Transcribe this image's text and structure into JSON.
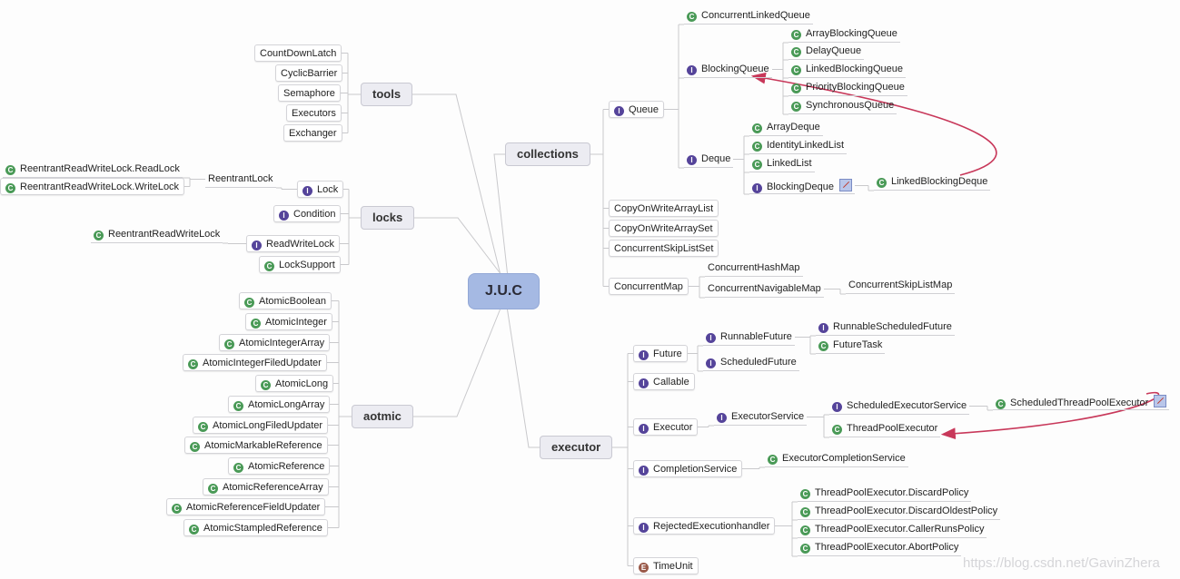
{
  "root": {
    "id": "juc",
    "label": "J.U.C"
  },
  "branches": [
    {
      "id": "tools",
      "label": "tools"
    },
    {
      "id": "locks",
      "label": "locks"
    },
    {
      "id": "aotmic",
      "label": "aotmic"
    },
    {
      "id": "collections",
      "label": "collections"
    },
    {
      "id": "executor",
      "label": "executor"
    }
  ],
  "nodes": [
    {
      "id": "t1",
      "label": "CountDownLatch",
      "kind": "none",
      "style": "box",
      "parent": "tools"
    },
    {
      "id": "t2",
      "label": "CyclicBarrier",
      "kind": "none",
      "style": "box",
      "parent": "tools"
    },
    {
      "id": "t3",
      "label": "Semaphore",
      "kind": "none",
      "style": "box",
      "parent": "tools"
    },
    {
      "id": "t4",
      "label": "Executors",
      "kind": "none",
      "style": "box",
      "parent": "tools"
    },
    {
      "id": "t5",
      "label": "Exchanger",
      "kind": "none",
      "style": "box",
      "parent": "tools"
    },
    {
      "id": "l1",
      "label": "Lock",
      "kind": "interface",
      "style": "box",
      "parent": "locks"
    },
    {
      "id": "l2",
      "label": "Condition",
      "kind": "interface",
      "style": "box",
      "parent": "locks"
    },
    {
      "id": "l3",
      "label": "ReadWriteLock",
      "kind": "interface",
      "style": "box",
      "parent": "locks"
    },
    {
      "id": "l4",
      "label": "LockSupport",
      "kind": "class",
      "style": "box",
      "parent": "locks"
    },
    {
      "id": "l1a",
      "label": "ReentrantLock",
      "kind": "none",
      "style": "plain",
      "parent": "l1"
    },
    {
      "id": "l1b",
      "label": "ReentrantReadWriteLock.ReadLock",
      "kind": "class",
      "style": "plain",
      "parent": "l1a"
    },
    {
      "id": "l1c",
      "label": "ReentrantReadWriteLock.WriteLock",
      "kind": "class",
      "style": "box",
      "parent": "l1a"
    },
    {
      "id": "l3a",
      "label": "ReentrantReadWriteLock",
      "kind": "class",
      "style": "plain",
      "parent": "l3"
    },
    {
      "id": "a1",
      "label": "AtomicBoolean",
      "kind": "class",
      "style": "box",
      "parent": "aotmic"
    },
    {
      "id": "a2",
      "label": "AtomicInteger",
      "kind": "class",
      "style": "box",
      "parent": "aotmic"
    },
    {
      "id": "a3",
      "label": "AtomicIntegerArray",
      "kind": "class",
      "style": "box",
      "parent": "aotmic"
    },
    {
      "id": "a4",
      "label": "AtomicIntegerFiledUpdater",
      "kind": "class",
      "style": "box",
      "parent": "aotmic"
    },
    {
      "id": "a5",
      "label": "AtomicLong",
      "kind": "class",
      "style": "box",
      "parent": "aotmic"
    },
    {
      "id": "a6",
      "label": "AtomicLongArray",
      "kind": "class",
      "style": "box",
      "parent": "aotmic"
    },
    {
      "id": "a7",
      "label": "AtomicLongFiledUpdater",
      "kind": "class",
      "style": "box",
      "parent": "aotmic"
    },
    {
      "id": "a8",
      "label": "AtomicMarkableReference",
      "kind": "class",
      "style": "box",
      "parent": "aotmic"
    },
    {
      "id": "a9",
      "label": "AtomicReference",
      "kind": "class",
      "style": "box",
      "parent": "aotmic"
    },
    {
      "id": "a10",
      "label": "AtomicReferenceArray",
      "kind": "class",
      "style": "box",
      "parent": "aotmic"
    },
    {
      "id": "a11",
      "label": "AtomicReferenceFieldUpdater",
      "kind": "class",
      "style": "box",
      "parent": "aotmic"
    },
    {
      "id": "a12",
      "label": "AtomicStampledReference",
      "kind": "class",
      "style": "box",
      "parent": "aotmic"
    },
    {
      "id": "c1",
      "label": "Queue",
      "kind": "interface",
      "style": "box",
      "parent": "collections"
    },
    {
      "id": "c1a",
      "label": "ConcurrentLinkedQueue",
      "kind": "class",
      "style": "plain",
      "parent": "c1"
    },
    {
      "id": "c1b",
      "label": "BlockingQueue",
      "kind": "interface",
      "style": "plain",
      "parent": "c1"
    },
    {
      "id": "c1b1",
      "label": "ArrayBlockingQueue",
      "kind": "class",
      "style": "plain",
      "parent": "c1b"
    },
    {
      "id": "c1b2",
      "label": "DelayQueue",
      "kind": "class",
      "style": "plain",
      "parent": "c1b"
    },
    {
      "id": "c1b3",
      "label": "LinkedBlockingQueue",
      "kind": "class",
      "style": "plain",
      "parent": "c1b"
    },
    {
      "id": "c1b4",
      "label": "PriorityBlockingQueue",
      "kind": "class",
      "style": "plain",
      "parent": "c1b"
    },
    {
      "id": "c1b5",
      "label": "SynchronousQueue",
      "kind": "class",
      "style": "plain",
      "parent": "c1b"
    },
    {
      "id": "c1c",
      "label": "Deque",
      "kind": "interface",
      "style": "plain",
      "parent": "c1"
    },
    {
      "id": "c1c1",
      "label": "ArrayDeque",
      "kind": "class",
      "style": "plain",
      "parent": "c1c"
    },
    {
      "id": "c1c2",
      "label": "IdentityLinkedList",
      "kind": "class",
      "style": "plain",
      "parent": "c1c"
    },
    {
      "id": "c1c3",
      "label": "LinkedList",
      "kind": "class",
      "style": "plain",
      "parent": "c1c"
    },
    {
      "id": "c1c4",
      "label": "BlockingDeque",
      "kind": "interface",
      "style": "plain",
      "parent": "c1c",
      "note": true
    },
    {
      "id": "c1c4a",
      "label": "LinkedBlockingDeque",
      "kind": "class",
      "style": "plain",
      "parent": "c1c4"
    },
    {
      "id": "c2",
      "label": "CopyOnWriteArrayList",
      "kind": "none",
      "style": "box",
      "parent": "collections"
    },
    {
      "id": "c3",
      "label": "CopyOnWriteArraySet",
      "kind": "none",
      "style": "box",
      "parent": "collections"
    },
    {
      "id": "c4",
      "label": "ConcurrentSkipListSet",
      "kind": "none",
      "style": "box",
      "parent": "collections"
    },
    {
      "id": "c5",
      "label": "ConcurrentMap",
      "kind": "none",
      "style": "box",
      "parent": "collections"
    },
    {
      "id": "c5a",
      "label": "ConcurrentHashMap",
      "kind": "none",
      "style": "plain",
      "parent": "c5"
    },
    {
      "id": "c5b",
      "label": "ConcurrentNavigableMap",
      "kind": "none",
      "style": "plain",
      "parent": "c5"
    },
    {
      "id": "c5b1",
      "label": "ConcurrentSkipListMap",
      "kind": "none",
      "style": "plain",
      "parent": "c5b"
    },
    {
      "id": "e1",
      "label": "Future",
      "kind": "interface",
      "style": "box",
      "parent": "executor"
    },
    {
      "id": "e1a",
      "label": "RunnableFuture",
      "kind": "interface",
      "style": "plain",
      "parent": "e1"
    },
    {
      "id": "e1a1",
      "label": "RunnableScheduledFuture",
      "kind": "interface",
      "style": "plain",
      "parent": "e1a"
    },
    {
      "id": "e1a2",
      "label": "FutureTask",
      "kind": "class",
      "style": "plain",
      "parent": "e1a"
    },
    {
      "id": "e1b",
      "label": "ScheduledFuture",
      "kind": "interface",
      "style": "plain",
      "parent": "e1"
    },
    {
      "id": "e2",
      "label": "Callable",
      "kind": "interface",
      "style": "box",
      "parent": "executor"
    },
    {
      "id": "e3",
      "label": "Executor",
      "kind": "interface",
      "style": "box",
      "parent": "executor"
    },
    {
      "id": "e3a",
      "label": "ExecutorService",
      "kind": "interface",
      "style": "plain",
      "parent": "e3"
    },
    {
      "id": "e3a1",
      "label": "ScheduledExecutorService",
      "kind": "interface",
      "style": "plain",
      "parent": "e3a"
    },
    {
      "id": "e3a1a",
      "label": "ScheduledThreadPoolExecutor",
      "kind": "class",
      "style": "plain",
      "parent": "e3a1",
      "note": true
    },
    {
      "id": "e3a2",
      "label": "ThreadPoolExecutor",
      "kind": "class",
      "style": "plain",
      "parent": "e3a"
    },
    {
      "id": "e4",
      "label": "CompletionService",
      "kind": "interface",
      "style": "box",
      "parent": "executor"
    },
    {
      "id": "e4a",
      "label": "ExecutorCompletionService",
      "kind": "class",
      "style": "plain",
      "parent": "e4"
    },
    {
      "id": "e5",
      "label": "RejectedExecutionhandler",
      "kind": "interface",
      "style": "box",
      "parent": "executor"
    },
    {
      "id": "e5a",
      "label": "ThreadPoolExecutor.DiscardPolicy",
      "kind": "class",
      "style": "plain",
      "parent": "e5"
    },
    {
      "id": "e5b",
      "label": "ThreadPoolExecutor.DiscardOldestPolicy",
      "kind": "class",
      "style": "plain",
      "parent": "e5"
    },
    {
      "id": "e5c",
      "label": "ThreadPoolExecutor.CallerRunsPolicy",
      "kind": "class",
      "style": "plain",
      "parent": "e5"
    },
    {
      "id": "e5d",
      "label": "ThreadPoolExecutor.AbortPolicy",
      "kind": "class",
      "style": "plain",
      "parent": "e5"
    },
    {
      "id": "e6",
      "label": "TimeUnit",
      "kind": "enum",
      "style": "box",
      "parent": "executor"
    }
  ],
  "relations": [
    {
      "from": "c1c4a",
      "to": "c1b",
      "color": "#c8385a"
    },
    {
      "from": "e3a1a",
      "to": "e3a2",
      "color": "#c8385a"
    }
  ],
  "icon_glyphs": {
    "class": "C",
    "interface": "I",
    "enum": "E"
  },
  "watermark": "https://blog.csdn.net/GavinZhera"
}
